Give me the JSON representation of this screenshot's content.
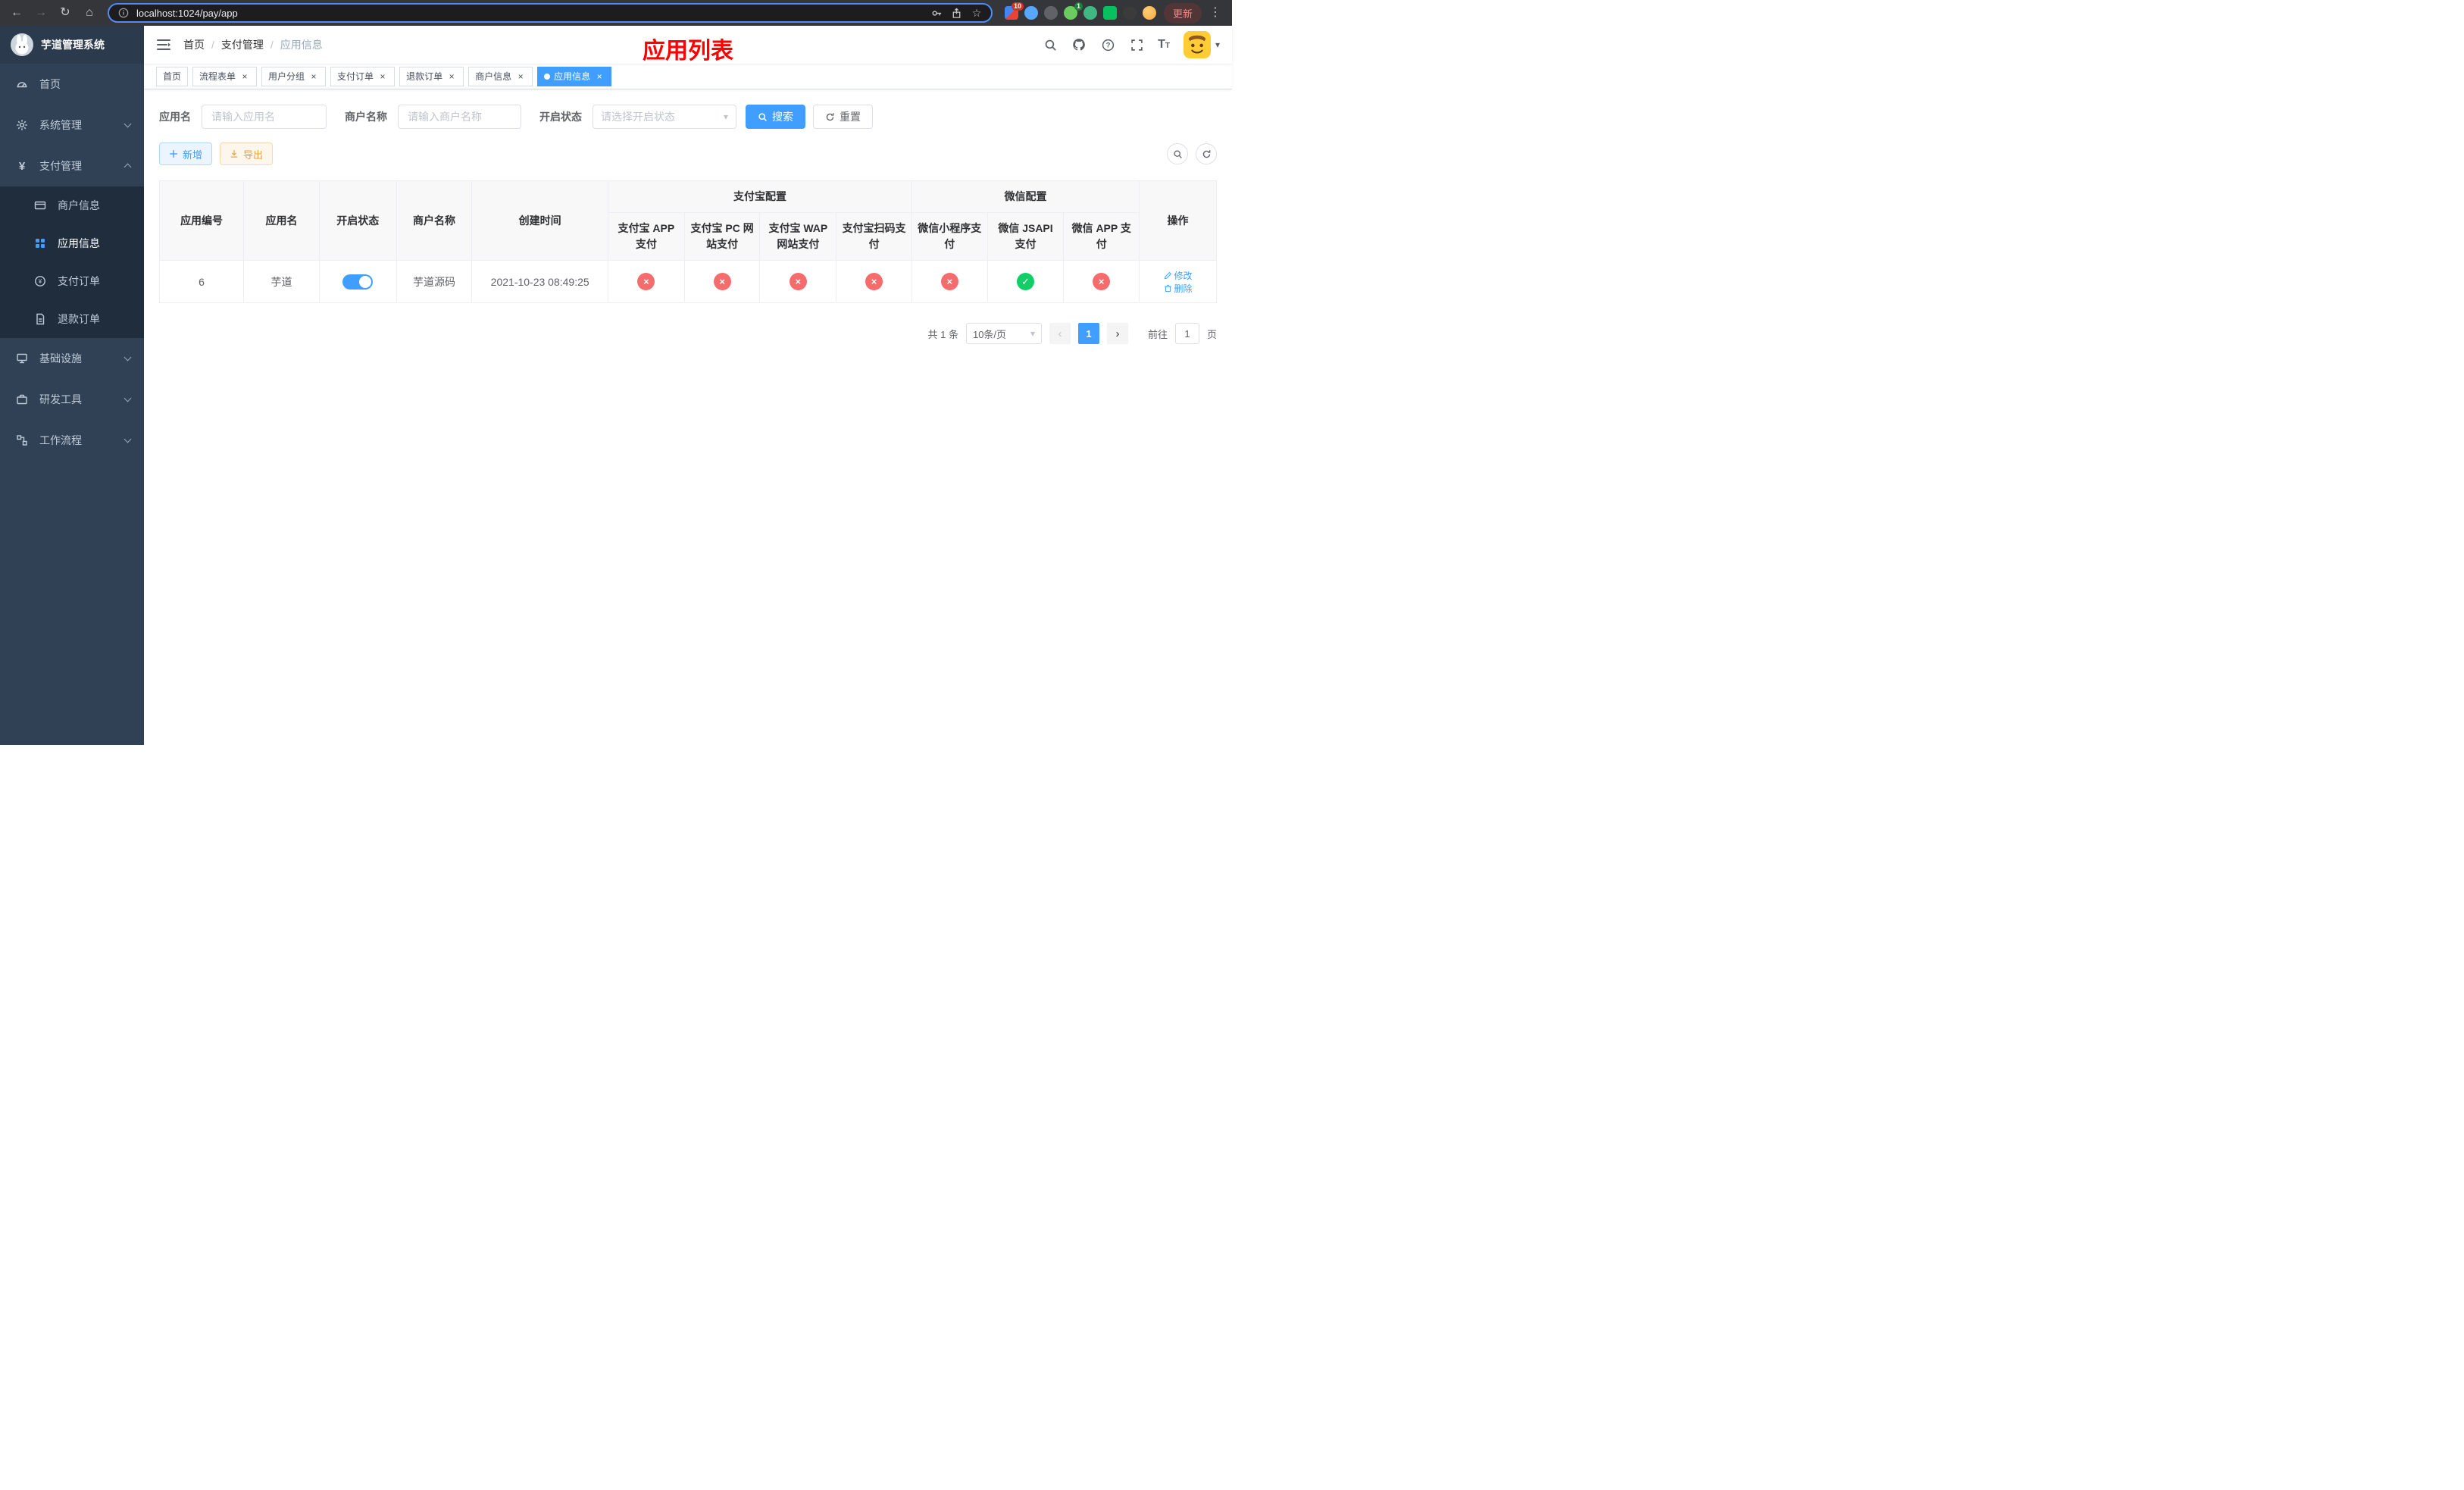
{
  "browser": {
    "url": "localhost:1024/pay/app",
    "update_label": "更新",
    "ext_badge_1": "10",
    "ext_badge_2": "1"
  },
  "icons": {
    "back": "←",
    "forward": "→",
    "reload": "↻",
    "home": "⌂",
    "star": "☆",
    "menu_dots": "⋮",
    "close": "×",
    "check": "✓",
    "prev": "‹",
    "next": "›",
    "caret": "▾",
    "yen": "¥"
  },
  "colors": {
    "primary": "#409eff",
    "success": "#13ce66",
    "danger": "#f56c6c",
    "warning": "#e6a23c",
    "page_title_red": "#ff0000",
    "sidebar_bg": "#304156"
  },
  "sidebar": {
    "logo_title": "芋道管理系统",
    "items": [
      {
        "label": "首页"
      },
      {
        "label": "系统管理"
      },
      {
        "label": "支付管理",
        "children": [
          {
            "label": "商户信息"
          },
          {
            "label": "应用信息"
          },
          {
            "label": "支付订单"
          },
          {
            "label": "退款订单"
          }
        ]
      },
      {
        "label": "基础设施"
      },
      {
        "label": "研发工具"
      },
      {
        "label": "工作流程"
      }
    ]
  },
  "navbar": {
    "breadcrumb": [
      "首页",
      "支付管理",
      "应用信息"
    ],
    "separator": "/",
    "page_title": "应用列表"
  },
  "tags": [
    {
      "label": "首页"
    },
    {
      "label": "流程表单"
    },
    {
      "label": "用户分组"
    },
    {
      "label": "支付订单"
    },
    {
      "label": "退款订单"
    },
    {
      "label": "商户信息"
    },
    {
      "label": "应用信息"
    }
  ],
  "filters": {
    "app_name_label": "应用名",
    "app_name_placeholder": "请输入应用名",
    "merchant_label": "商户名称",
    "merchant_placeholder": "请输入商户名称",
    "status_label": "开启状态",
    "status_placeholder": "请选择开启状态",
    "search_label": "搜索",
    "reset_label": "重置"
  },
  "toolbar": {
    "add_label": "新增",
    "export_label": "导出"
  },
  "table": {
    "headers": {
      "app_id": "应用编号",
      "app_name": "应用名",
      "status": "开启状态",
      "merchant": "商户名称",
      "created": "创建时间",
      "alipay_group": "支付宝配置",
      "wechat_group": "微信配置",
      "actions": "操作"
    },
    "sub_headers": [
      "支付宝 APP 支付",
      "支付宝 PC 网站支付",
      "支付宝 WAP 网站支付",
      "支付宝扫码支付",
      "微信小程序支付",
      "微信 JSAPI 支付",
      "微信 APP 支付"
    ],
    "row": {
      "app_id": "6",
      "app_name": "芋道",
      "status_enabled": true,
      "merchant": "芋道源码",
      "created": "2021-10-23 08:49:25",
      "configs": [
        "disabled",
        "disabled",
        "disabled",
        "disabled",
        "disabled",
        "enabled",
        "disabled"
      ],
      "edit_label": "修改",
      "delete_label": "删除"
    }
  },
  "pagination": {
    "total_label": "共 1 条",
    "page_size_label": "10条/页",
    "current_page": "1",
    "goto_label": "前往",
    "goto_value": "1",
    "page_unit_label": "页"
  }
}
